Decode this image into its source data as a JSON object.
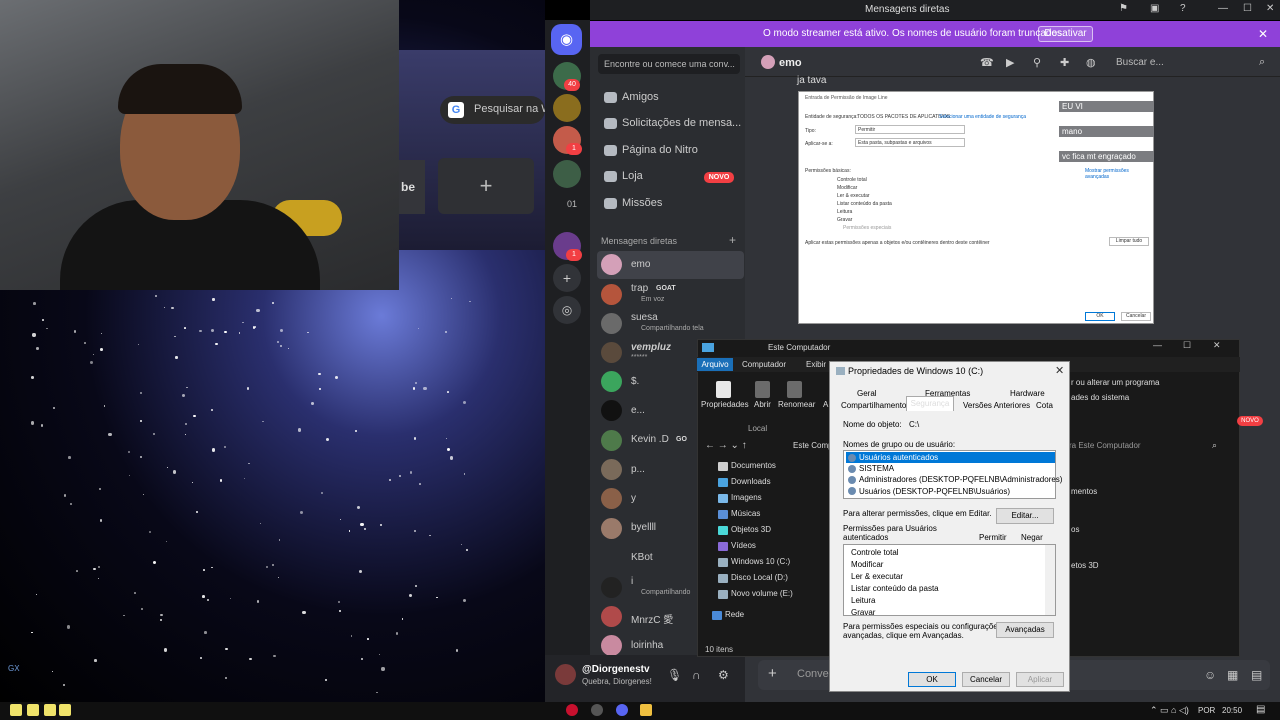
{
  "browser": {
    "search_placeholder": "Pesquisar na W",
    "tile_fragment": "be",
    "new_tile": "+",
    "google_icon": "G"
  },
  "stream": {
    "corner_label": "GX",
    "corner_dots": "..."
  },
  "discord": {
    "window_title": "Mensagens diretas",
    "streamer_banner": "O modo streamer está ativo. Os nomes de usuário foram truncados.",
    "streamer_button": "Desativar",
    "servers": {
      "badge_1": "40",
      "badge_2": "1",
      "server_label_3": "01",
      "badge_3": "1"
    },
    "search_placeholder": "Encontre ou comece uma conv...",
    "nav": [
      {
        "label": "Amigos",
        "icon": "friends-icon"
      },
      {
        "label": "Solicitações de mensa...",
        "icon": "mail-icon"
      },
      {
        "label": "Página do Nitro",
        "icon": "nitro-icon"
      },
      {
        "label": "Loja",
        "icon": "shop-icon",
        "badge": "NOVO"
      },
      {
        "label": "Missões",
        "icon": "quest-icon"
      }
    ],
    "dm_header": "Mensagens diretas",
    "dm_plus": "+",
    "dms": [
      {
        "name": "emo",
        "sub": ""
      },
      {
        "name": "trap",
        "tag": "GOAT",
        "sub": "Em voz"
      },
      {
        "name": "suesa",
        "sub": "Compartilhando tela"
      },
      {
        "name": "vempluz",
        "sub": "******"
      },
      {
        "name": "$.",
        "sub": ""
      },
      {
        "name": "e...",
        "sub": ""
      },
      {
        "name": "Kevin .D",
        "tag": "GO",
        "sub": ""
      },
      {
        "name": "p...",
        "sub": ""
      },
      {
        "name": "y",
        "sub": ""
      },
      {
        "name": "byellll",
        "sub": ""
      },
      {
        "name": "KBot",
        "sub": ""
      },
      {
        "name": "i",
        "sub": "Compartilhando"
      },
      {
        "name": "MnrzC 愛",
        "sub": ""
      },
      {
        "name": "loirinha",
        "sub": ""
      }
    ],
    "user": {
      "name": "@Diorgenestv",
      "status": "Quebra, Diorgenes!"
    },
    "chat": {
      "recipient": "emo",
      "search_placeholder": "Buscar e...",
      "message": "ja tava",
      "input_placeholder": "Conve"
    },
    "overlay": [
      "EU VI",
      "mano",
      "vc fica mt engraçado"
    ],
    "novo_side": "NOVO"
  },
  "perm_entry_window": {
    "title": "Entrada de Permissão de Image Line",
    "principal_label": "Entidade de segurança:",
    "principal_value": "TODOS OS PACOTES DE APLICATIVOS",
    "principal_link": "Selecionar uma entidade de segurança",
    "type_label": "Tipo:",
    "type_value": "Permitir",
    "applies_label": "Aplicar-se a:",
    "applies_value": "Esta pasta, subpastas e arquivos",
    "basic_label": "Permissões básicas:",
    "advanced_link": "Mostrar permissões avançadas",
    "perms": [
      "Controle total",
      "Modificar",
      "Ler & executar",
      "Listar conteúdo da pasta",
      "Leitura",
      "Gravar",
      "Permissões especiais"
    ],
    "apply_only": "Aplicar estas permissões apenas a objetos e/ou contêineres dentro deste contêiner",
    "clear_all": "Limpar tudo",
    "ok": "OK",
    "cancel": "Cancelar"
  },
  "explorer": {
    "title": "Este Computador",
    "tabs": [
      "Arquivo",
      "Computador",
      "Exibir"
    ],
    "ribbon": [
      "Propriedades",
      "Abrir",
      "Renomear",
      "A"
    ],
    "ribbon_group": "Local",
    "path": "Este Comp",
    "search_placeholder": "ra Este Computador",
    "tree": [
      "Documentos",
      "Downloads",
      "Imagens",
      "Músicas",
      "Objetos 3D",
      "Vídeos",
      "Windows 10 (C:)",
      "Disco Local (D:)",
      "Novo volume (E:)",
      "Rede"
    ],
    "status": "10 itens",
    "right_snippets": [
      "r ou alterar um programa",
      "ades do sistema",
      "mentos",
      "os",
      "etos 3D"
    ]
  },
  "properties": {
    "title": "Propriedades de Windows 10 (C:)",
    "tabs_row1": [
      "Geral",
      "Ferramentas",
      "Hardware"
    ],
    "tabs_row2": [
      "Compartilhamento",
      "Segurança",
      "Versões Anteriores",
      "Cota"
    ],
    "object_label": "Nome do objeto:",
    "object_value": "C:\\",
    "groups_label": "Nomes de grupo ou de usuário:",
    "groups": [
      "Usuários autenticados",
      "SISTEMA",
      "Administradores (DESKTOP-PQFELNB\\Administradores)",
      "Usuários (DESKTOP-PQFELNB\\Usuários)"
    ],
    "change_hint": "Para alterar permissões, clique em Editar.",
    "edit_button": "Editar...",
    "perms_for_line1": "Permissões para Usuários",
    "perms_for_line2": "autenticados",
    "allow": "Permitir",
    "deny": "Negar",
    "perms": [
      "Controle total",
      "Modificar",
      "Ler & executar",
      "Listar conteúdo da pasta",
      "Leitura",
      "Gravar"
    ],
    "special_hint_1": "Para permissões especiais ou configurações",
    "special_hint_2": "avançadas, clique em Avançadas.",
    "advanced_button": "Avançadas",
    "ok": "OK",
    "cancel": "Cancelar",
    "apply": "Aplicar"
  },
  "taskbar": {
    "lang": "POR",
    "time": "20:50"
  },
  "colors": {
    "discord_blurple": "#5865f2",
    "streamer_purple": "#8f41d9",
    "selection_blue": "#0078d7",
    "danger_red": "#f23f43"
  }
}
